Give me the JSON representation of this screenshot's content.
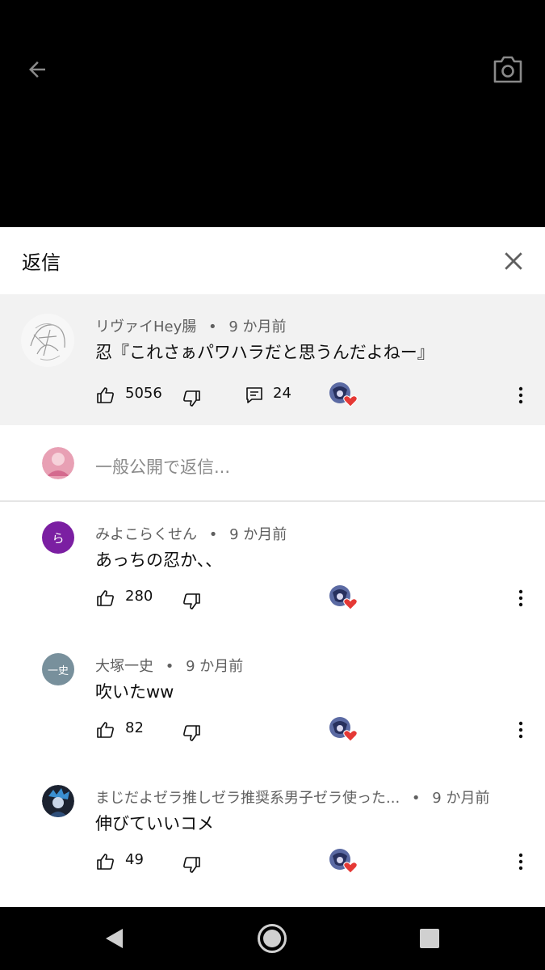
{
  "panel": {
    "title": "返信"
  },
  "parent_comment": {
    "author": "リヴァイHey腸",
    "time": "9 か月前",
    "separator": "•",
    "text": "忍『これさぁパワハラだと思うんだよねー』",
    "likes": "5056",
    "replies": "24"
  },
  "reply_input": {
    "placeholder": "一般公開で返信..."
  },
  "replies": [
    {
      "author": "みよこらくせん",
      "time": "9 か月前",
      "separator": "•",
      "text": "あっちの忍か、、",
      "likes": "280",
      "avatar_letter": "ら",
      "avatar_color": "#7b1fa2"
    },
    {
      "author": "大塚一史",
      "time": "9 か月前",
      "separator": "•",
      "text": "吹いたww",
      "likes": "82",
      "avatar_letter": "一史",
      "avatar_color": "#78909c"
    },
    {
      "author": "まじだよゼラ推しゼラ推奨系男子ゼラ使った...",
      "time": "9 か月前",
      "separator": "•",
      "text": "伸びていいコメ",
      "likes": "49"
    }
  ],
  "colors": {
    "heart": "#e53935",
    "panel_bg": "#ffffff",
    "highlight_bg": "#f2f2f2",
    "meta_text": "#606060"
  },
  "icons": [
    "back-arrow-icon",
    "camera-icon",
    "close-icon",
    "thumbs-up-icon",
    "thumbs-down-icon",
    "reply-icon",
    "more-vert-icon",
    "heart-icon",
    "nav-back-icon",
    "nav-home-icon",
    "nav-recents-icon"
  ]
}
